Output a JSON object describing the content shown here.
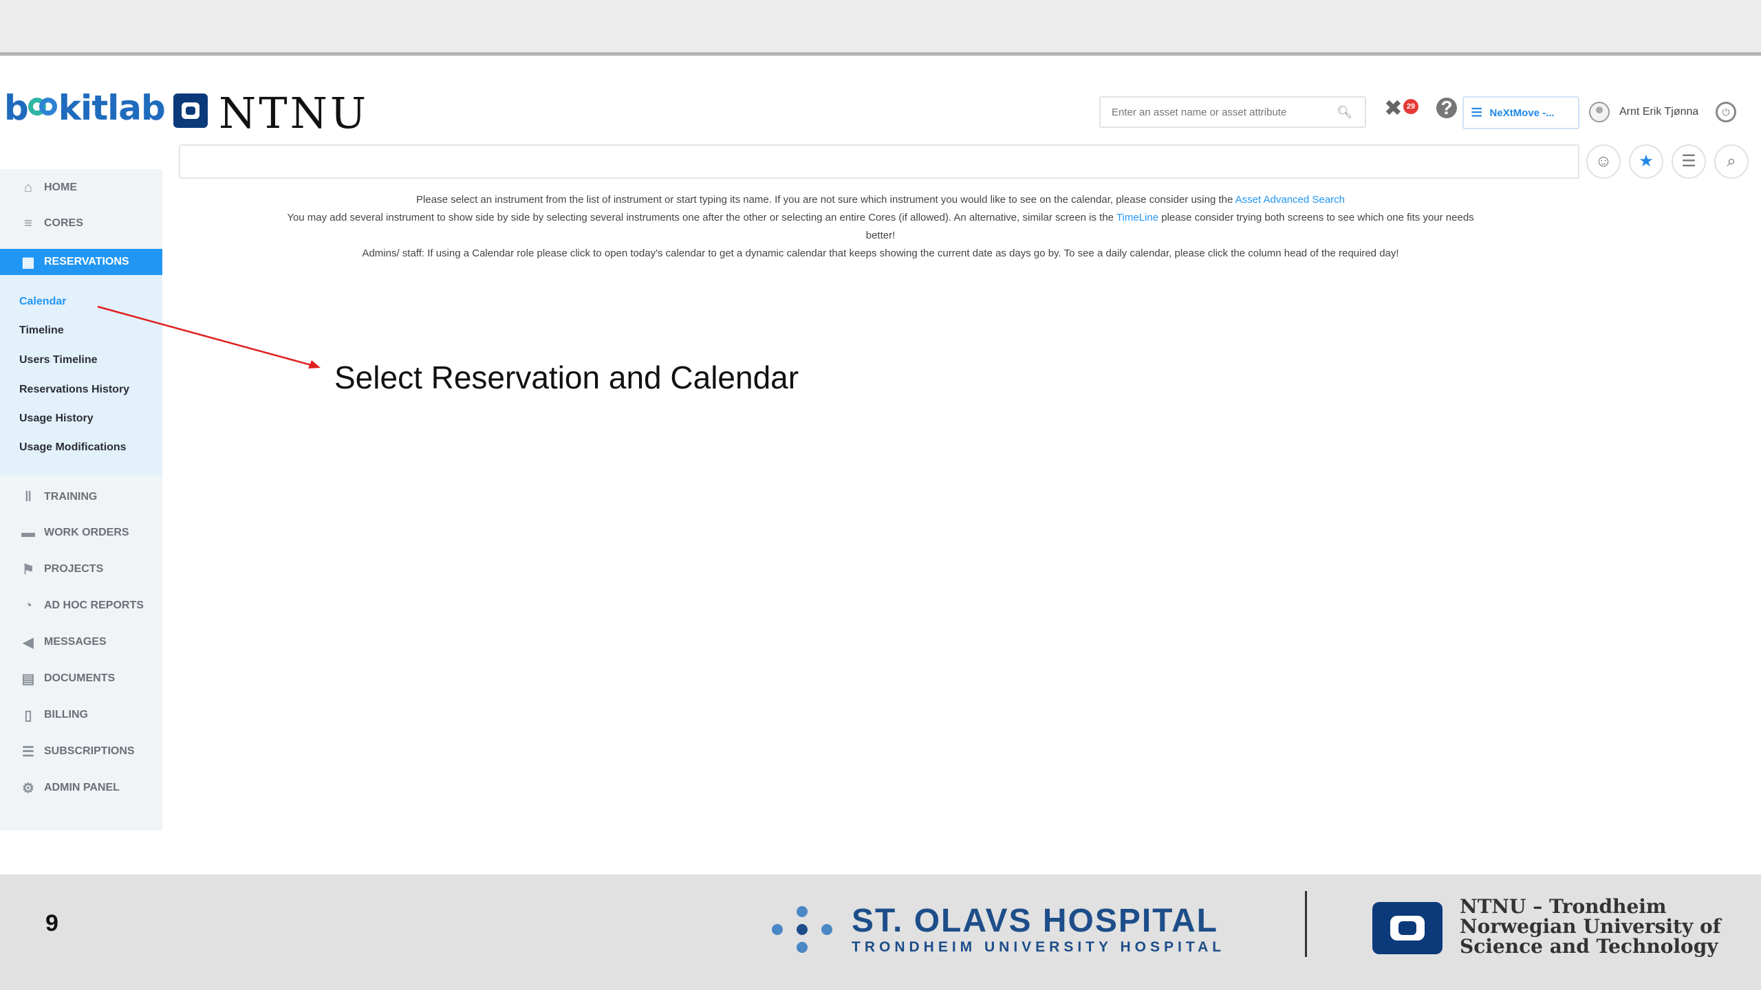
{
  "brand": {
    "name_prefix": "b",
    "name_suffix": "kitlab",
    "institution": "NTNU"
  },
  "header": {
    "search_placeholder": "Enter an asset name or asset attribute",
    "notification_count": "29",
    "project_label": "NeXtMove -...",
    "user_name": "Arnt Erik Tjønna"
  },
  "nav": {
    "items": [
      {
        "label": "HOME",
        "icon": "home-icon"
      },
      {
        "label": "CORES",
        "icon": "layers-icon"
      },
      {
        "label": "RESERVATIONS",
        "icon": "calendar-icon"
      },
      {
        "label": "TRAINING",
        "icon": "dumbbell-icon"
      },
      {
        "label": "WORK ORDERS",
        "icon": "comment-icon"
      },
      {
        "label": "PROJECTS",
        "icon": "flag-icon"
      },
      {
        "label": "AD HOC REPORTS",
        "icon": "pie-chart-icon"
      },
      {
        "label": "MESSAGES",
        "icon": "megaphone-icon"
      },
      {
        "label": "DOCUMENTS",
        "icon": "folder-icon"
      },
      {
        "label": "BILLING",
        "icon": "invoice-icon"
      },
      {
        "label": "SUBSCRIPTIONS",
        "icon": "list-icon"
      },
      {
        "label": "ADMIN PANEL",
        "icon": "gear-icon"
      }
    ],
    "submenu": [
      "Calendar",
      "Timeline",
      "Users Timeline",
      "Reservations History",
      "Usage History",
      "Usage Modifications"
    ]
  },
  "info": {
    "line1_a": "Please select an instrument from the list of instrument or start typing its name. If you are not sure which instrument you would like to see on the calendar, please consider using the",
    "line1_link": "Asset Advanced Search",
    "line2_a": "You may add several instrument to show side by side by selecting several instruments one after the other or selecting an entire Cores (if allowed). An alternative, similar screen is the",
    "line2_link": "TimeLine",
    "line2_b": "please consider trying both screens to see which one fits your needs",
    "line2_c": "better!",
    "line3": "Admins/ staff: If using a Calendar role please click to open today's calendar to get a dynamic calendar that keeps showing the current date as days go by. To see a daily calendar, please click the column head of the required day!"
  },
  "annotation": "Select Reservation and Calendar",
  "footer": {
    "slide_number": "9",
    "hospital_name": "ST. OLAVS HOSPITAL",
    "hospital_sub": "TRONDHEIM UNIVERSITY HOSPITAL",
    "ntnu_line1": "NTNU – Trondheim",
    "ntnu_line2": "Norwegian University of",
    "ntnu_line3": "Science and Technology"
  },
  "colors": {
    "accent": "#2196f3",
    "submenu_bg": "#e3f1fb",
    "hospital_blue": "#1d4e89",
    "ntnu_blue": "#0b3a7a"
  }
}
